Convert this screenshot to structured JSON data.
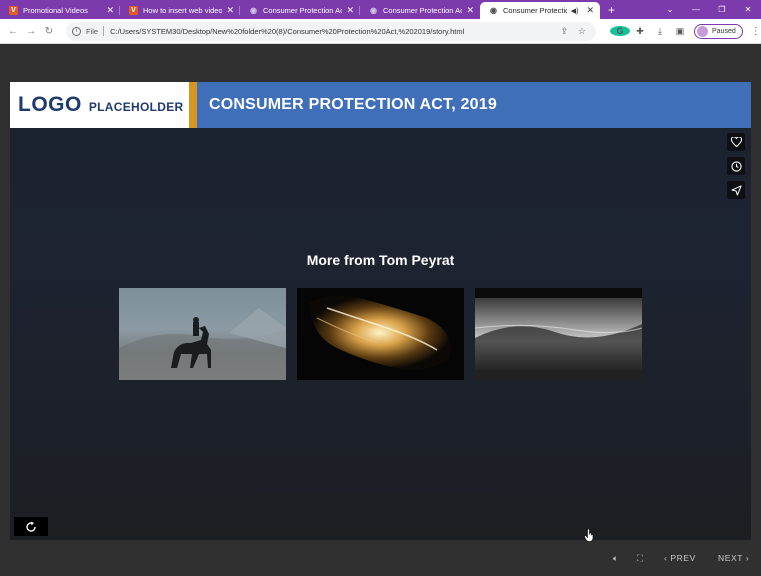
{
  "browser": {
    "tabs": [
      {
        "title": "Promotional Videos",
        "favicon": "V",
        "active": false
      },
      {
        "title": "How to insert web video",
        "favicon": "V",
        "active": false
      },
      {
        "title": "Consumer Protection Act",
        "favicon": "globe",
        "active": false
      },
      {
        "title": "Consumer Protection Act",
        "favicon": "globe",
        "active": false
      },
      {
        "title": "Consumer Protection",
        "favicon": "globe",
        "active": true
      }
    ],
    "new_tab": "+",
    "address": {
      "scheme_label": "File",
      "url": "C:/Users/SYSTEM30/Desktop/New%20folder%20(8)/Consumer%20Protection%20Act,%202019/story.html"
    },
    "profile_status": "Paused",
    "accent_color": "#7c3aad"
  },
  "course": {
    "logo_word": "LOGO",
    "logo_sub": "PLACEHOLDER",
    "title": "CONSUMER PROTECTION ACT, 2019",
    "header_color": "#3f6fb8",
    "accent_color": "#d9961e"
  },
  "video_end": {
    "more_title": "More from Tom Peyrat",
    "thumbnails": [
      "horse-rider-thumbnail",
      "liquid-gold-thumbnail",
      "waves-bw-thumbnail"
    ]
  },
  "side_icons": [
    "heart-icon",
    "clock-icon",
    "send-icon"
  ],
  "controls": {
    "prev_label": "PREV",
    "next_label": "NEXT"
  }
}
